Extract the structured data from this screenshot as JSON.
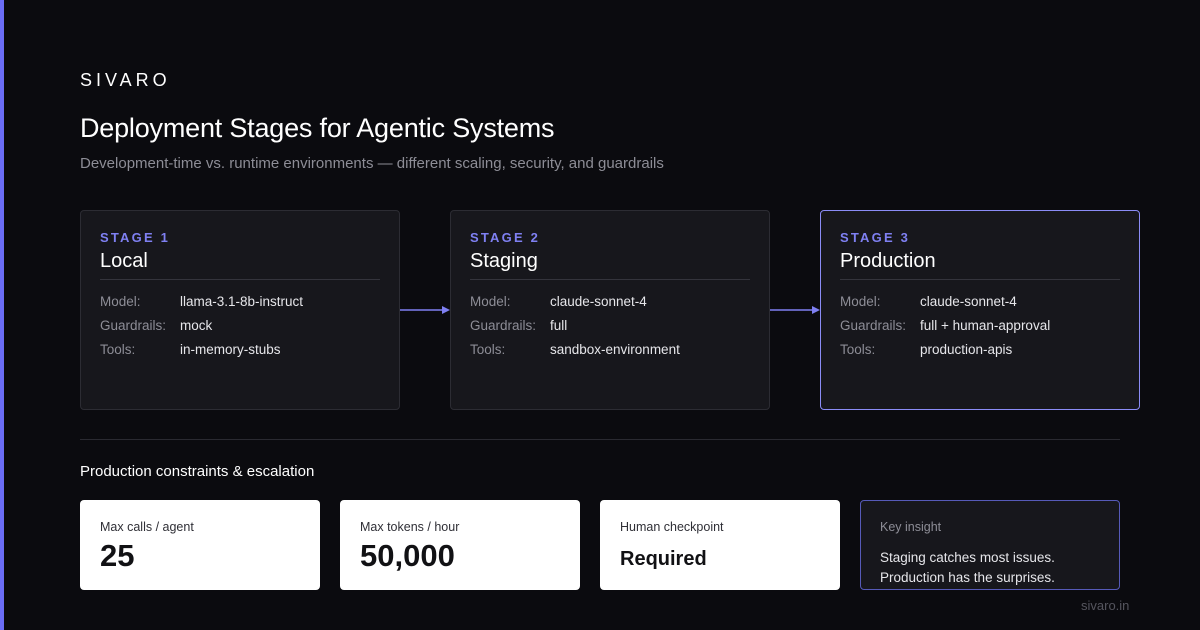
{
  "brand": "SIVARO",
  "title": "Deployment Stages for Agentic Systems",
  "subtitle": "Development-time vs. runtime environments — different scaling, security, and guardrails",
  "stages": [
    {
      "label": "STAGE 1",
      "name": "Local",
      "rows": [
        {
          "key": "Model:",
          "value": "llama-3.1-8b-instruct"
        },
        {
          "key": "Guardrails:",
          "value": "mock"
        },
        {
          "key": "Tools:",
          "value": "in-memory-stubs"
        }
      ]
    },
    {
      "label": "STAGE 2",
      "name": "Staging",
      "rows": [
        {
          "key": "Model:",
          "value": "claude-sonnet-4"
        },
        {
          "key": "Guardrails:",
          "value": "full"
        },
        {
          "key": "Tools:",
          "value": "sandbox-environment"
        }
      ]
    },
    {
      "label": "STAGE 3",
      "name": "Production",
      "rows": [
        {
          "key": "Model:",
          "value": "claude-sonnet-4"
        },
        {
          "key": "Guardrails:",
          "value": "full + human-approval"
        },
        {
          "key": "Tools:",
          "value": "production-apis"
        }
      ]
    }
  ],
  "section_title": "Production constraints & escalation",
  "metrics": [
    {
      "label": "Max calls / agent",
      "value": "25"
    },
    {
      "label": "Max tokens / hour",
      "value": "50,000"
    },
    {
      "label": "Human checkpoint",
      "value": "Required"
    }
  ],
  "insight": {
    "label": "Key insight",
    "text": "Staging catches most issues. Production has the surprises."
  },
  "footer": "sivaro.in",
  "colors": {
    "background": "#0b0b0f",
    "accent": "#7f80f2",
    "card": "#17171c",
    "active_border": "#8b8cf6"
  }
}
